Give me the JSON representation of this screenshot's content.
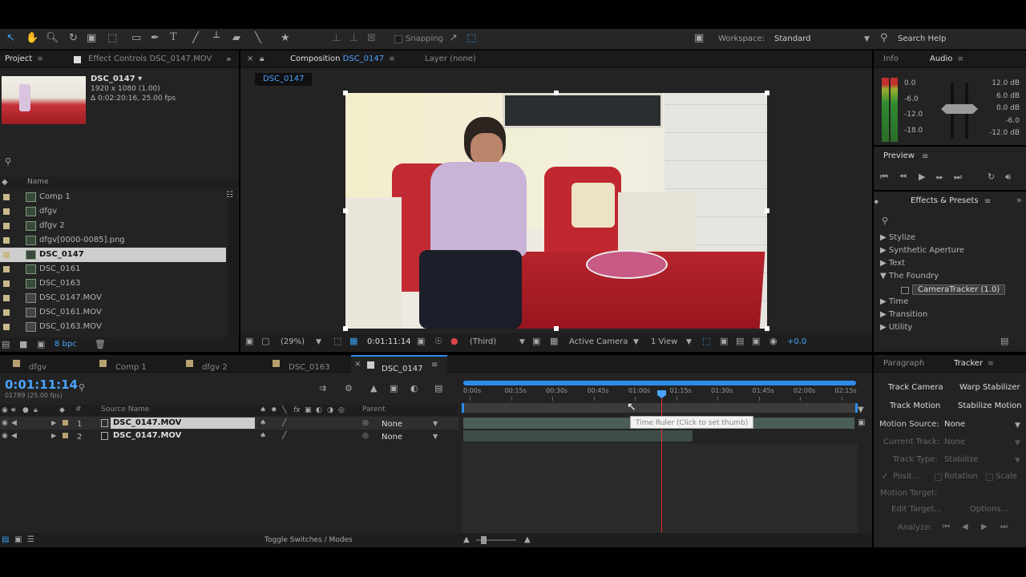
{
  "toolbar": {
    "snapping_label": "Snapping",
    "workspace_label": "Workspace:",
    "workspace_value": "Standard",
    "search_help": "Search Help"
  },
  "project": {
    "tab_project": "Project",
    "tab_effect_controls": "Effect Controls DSC_0147.MOV",
    "item_name": "DSC_0147 ▾",
    "item_dims": "1920 x 1080 (1.00)",
    "item_duration": "Δ 0:02:20:16, 25.00 fps",
    "col_name": "Name",
    "items": [
      {
        "name": "Comp 1",
        "type": "comp"
      },
      {
        "name": "dfgv",
        "type": "comp"
      },
      {
        "name": "dfgv 2",
        "type": "comp"
      },
      {
        "name": "dfgv[0000-0085].png",
        "type": "seq"
      },
      {
        "name": "DSC_0147",
        "type": "comp"
      },
      {
        "name": "DSC_0161",
        "type": "comp"
      },
      {
        "name": "DSC_0163",
        "type": "comp"
      },
      {
        "name": "DSC_0147.MOV",
        "type": "file"
      },
      {
        "name": "DSC_0161.MOV",
        "type": "file"
      },
      {
        "name": "DSC_0163.MOV",
        "type": "file"
      }
    ],
    "selected_index": 4,
    "bpc": "8 bpc"
  },
  "composition": {
    "tab_label": "Composition",
    "tab_comp_name": "DSC_0147",
    "layer_tab": "Layer (none)",
    "breadcrumb": "DSC_0147",
    "zoom": "(29%)",
    "timecode": "0:01:11:14",
    "resolution": "(Third)",
    "camera": "Active Camera",
    "views": "1 View",
    "exposure": "+0.0"
  },
  "info": {
    "tab_info": "Info",
    "tab_audio": "Audio",
    "audio_left_labels": [
      "0.0",
      "-6.0",
      "-12.0",
      "-18.0"
    ],
    "audio_right_labels": [
      "12.0 dB",
      "6.0 dB",
      "0.0 dB",
      "-6.0",
      "-12.0 dB"
    ]
  },
  "preview": {
    "title": "Preview"
  },
  "effects": {
    "title": "Effects & Presets",
    "items": [
      {
        "label": "▶ Stylize"
      },
      {
        "label": "▶ Synthetic Aperture"
      },
      {
        "label": "▶ Text"
      },
      {
        "label": "▼ The Foundry"
      },
      {
        "label": "CameraTracker (1.0)"
      },
      {
        "label": "▶ Time"
      },
      {
        "label": "▶ Transition"
      },
      {
        "label": "▶ Utility"
      }
    ]
  },
  "timeline": {
    "tabs": [
      "dfgv",
      "Comp 1",
      "dfgv 2",
      "DSC_0163",
      "DSC_0147"
    ],
    "timecode": "0:01:11:14",
    "frame_info": "01789 (25.00 fps)",
    "col_source": "Source Name",
    "col_parent": "Parent",
    "layers": [
      {
        "num": "1",
        "name": "DSC_0147.MOV",
        "parent": "None"
      },
      {
        "num": "2",
        "name": "DSC_0147.MOV",
        "parent": "None"
      }
    ],
    "ruler": [
      "0:00s",
      "00:15s",
      "00:30s",
      "00:45s",
      "01:00s",
      "01:15s",
      "01:30s",
      "01:45s",
      "02:00s",
      "02:15s"
    ],
    "tooltip": "Time Ruler (Click to set thumb)",
    "toggle_label": "Toggle Switches / Modes"
  },
  "tracker": {
    "tab_paragraph": "Paragraph",
    "tab_tracker": "Tracker",
    "track_camera": "Track Camera",
    "warp_stabilizer": "Warp Stabilizer",
    "track_motion": "Track Motion",
    "stabilize_motion": "Stabilize Motion",
    "motion_source_label": "Motion Source:",
    "motion_source_value": "None",
    "current_track_label": "Current Track:",
    "current_track_value": "None",
    "track_type_label": "Track Type:",
    "track_type_value": "Stabilize",
    "position": "Posit...",
    "rotation": "Rotation",
    "scale": "Scale",
    "motion_target_label": "Motion Target:",
    "edit_target": "Edit Target...",
    "options": "Options...",
    "analyze_label": "Analyze:"
  },
  "colors": {
    "accent_blue": "#2d8ceb",
    "timecode_blue": "#4aa3ff",
    "playhead_red": "#e0302a",
    "panel_bg": "#232323"
  }
}
